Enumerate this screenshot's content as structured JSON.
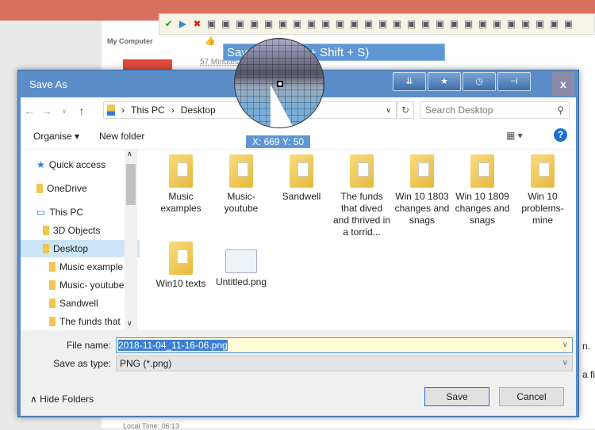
{
  "background": {
    "my_computer": "My Computer",
    "time_ago": "57 Minutes",
    "side_text_1": "n.",
    "side_text_2": "a fi",
    "local_time": "Local Time: 06:13"
  },
  "toolbar": {
    "icons": [
      "check-icon",
      "play-icon",
      "cancel-icon",
      "save-icon",
      "save-as-icon",
      "clipboard-icon",
      "upload-icon",
      "print-icon",
      "rectangle-icon",
      "ellipse-icon",
      "pencil-icon",
      "line-icon",
      "arrow-icon",
      "text-icon",
      "text-box-icon",
      "callout-icon",
      "counter-icon",
      "highlight-icon",
      "image-icon",
      "stamp-icon",
      "cursor-icon",
      "blur-icon",
      "grid-icon",
      "spellcheck-icon",
      "crop-icon",
      "border-color-icon",
      "fill-color-icon",
      "options-icon",
      "tools-icon"
    ]
  },
  "tooltip": "Save As... (Ctrl + Shift + S)",
  "magnifier": {
    "coords": "X: 669 Y: 50"
  },
  "dialog": {
    "title": "Save As",
    "close": "x",
    "breadcrumb": [
      "This PC",
      "Desktop"
    ],
    "search_placeholder": "Search Desktop",
    "organise": "Organise ▾",
    "new_folder": "New folder",
    "nav": [
      {
        "label": "Quick access",
        "icon": "star-icon"
      },
      {
        "label": "OneDrive",
        "icon": "folder-icon"
      },
      {
        "label": "This PC",
        "icon": "computer-icon"
      },
      {
        "label": "3D Objects",
        "icon": "folder-icon"
      },
      {
        "label": "Desktop",
        "icon": "folder-icon",
        "selected": true
      },
      {
        "label": "Music example",
        "icon": "folder-icon"
      },
      {
        "label": "Music- youtube",
        "icon": "folder-icon"
      },
      {
        "label": "Sandwell",
        "icon": "folder-icon"
      },
      {
        "label": "The funds that",
        "icon": "folder-icon"
      }
    ],
    "files": [
      {
        "name": "Music examples"
      },
      {
        "name": "Music- youtube"
      },
      {
        "name": "Sandwell"
      },
      {
        "name": "The funds that dived and thrived in a torrid..."
      },
      {
        "name": "Win 10 1803 changes and snags"
      },
      {
        "name": "Win 10 1809 changes and snags"
      },
      {
        "name": "Win 10 problems- mine"
      },
      {
        "name": "Win10 texts"
      },
      {
        "name": "Untitled.png"
      }
    ],
    "file_name_label": "File name:",
    "file_name": "2018-11-04_11-16-06.png",
    "save_type_label": "Save as type:",
    "save_type": "PNG (*.png)",
    "hide_folders": "Hide Folders",
    "save": "Save",
    "cancel": "Cancel"
  }
}
